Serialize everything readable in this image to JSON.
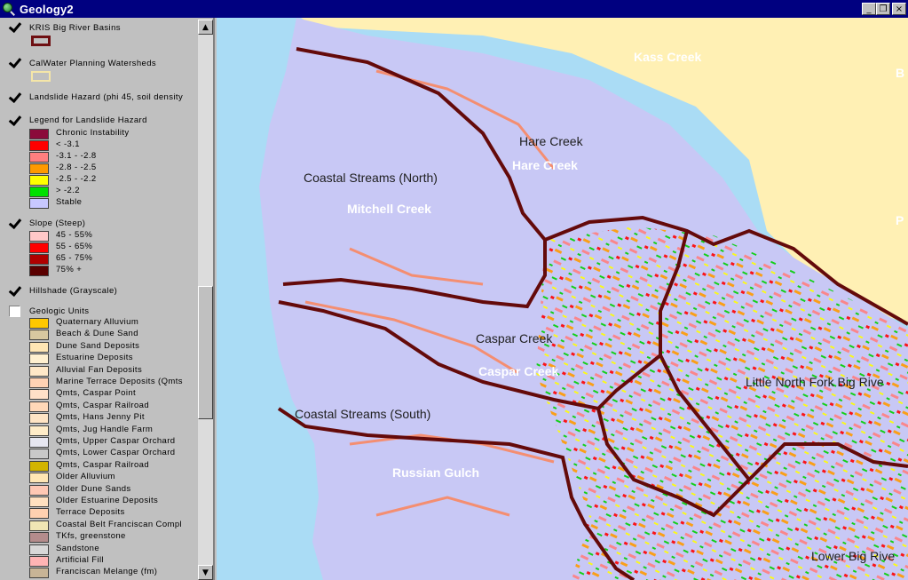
{
  "window": {
    "title": "Geology2",
    "buttons": {
      "minimize": "_",
      "restore": "❐",
      "close": "×"
    }
  },
  "legend": {
    "themes": [
      {
        "label": "KRIS Big River Basins",
        "checked": true,
        "symbol_color": "#6e0f12",
        "symbol_fill": "#c0c0c0"
      },
      {
        "label": "CalWater Planning Watersheds",
        "checked": true,
        "symbol_color": "#f5e6a8",
        "symbol_fill": "#c0c0c0"
      },
      {
        "label": "Landslide Hazard (phi 45, soil density",
        "checked": true
      },
      {
        "label": "Legend for Landslide Hazard",
        "checked": true,
        "classes": [
          {
            "label": "Chronic Instability",
            "color": "#8b0a3a"
          },
          {
            "label": "<  -3.1",
            "color": "#ff0000"
          },
          {
            "label": "-3.1 - -2.8",
            "color": "#ff7f7f"
          },
          {
            "label": "-2.8 - -2.5",
            "color": "#ff9a00"
          },
          {
            "label": "-2.5 - -2.2",
            "color": "#ffff00"
          },
          {
            "label": ">  -2.2",
            "color": "#00e000"
          },
          {
            "label": "Stable",
            "color": "#c8c8ff"
          }
        ]
      },
      {
        "label": "Slope (Steep)",
        "checked": true,
        "classes": [
          {
            "label": "45 - 55%",
            "color": "#ffc8c8"
          },
          {
            "label": "55 - 65%",
            "color": "#ff0000"
          },
          {
            "label": "65 - 75%",
            "color": "#b00000"
          },
          {
            "label": "75% +",
            "color": "#5a0000"
          }
        ]
      },
      {
        "label": "Hillshade (Grayscale)",
        "checked": true
      },
      {
        "label": "Geologic Units",
        "checked": false,
        "classes": [
          {
            "label": "Quaternary Alluvium",
            "color": "#ffc800"
          },
          {
            "label": "Beach & Dune Sand",
            "color": "#d8c8a0"
          },
          {
            "label": "Dune Sand Deposits",
            "color": "#ffe6b4"
          },
          {
            "label": "Estuarine Deposits",
            "color": "#fff0d0"
          },
          {
            "label": "Alluvial Fan Deposits",
            "color": "#ffe8c8"
          },
          {
            "label": "Marine Terrace Deposits (Qmts",
            "color": "#ffd2b4"
          },
          {
            "label": "Qmts, Caspar Point",
            "color": "#ffe0c8"
          },
          {
            "label": "Qmts, Caspar Railroad",
            "color": "#ffd8b8"
          },
          {
            "label": "Qmts, Hans Jenny Pit",
            "color": "#ffe4c4"
          },
          {
            "label": "Qmts, Jug Handle Farm",
            "color": "#ffecc8"
          },
          {
            "label": "Qmts, Upper Caspar Orchard",
            "color": "#e6e6f0"
          },
          {
            "label": "Qmts, Lower Caspar Orchard",
            "color": "#c8c8c8"
          },
          {
            "label": "Qmts, Caspar Railroad",
            "color": "#d2b400"
          },
          {
            "label": "Older Alluvium",
            "color": "#ffe6b4"
          },
          {
            "label": "Older Dune Sands",
            "color": "#ffc8b4"
          },
          {
            "label": "Older Estuarine Deposits",
            "color": "#ffe0c0"
          },
          {
            "label": "Terrace Deposits",
            "color": "#ffd0b0"
          },
          {
            "label": "Coastal Belt Franciscan Compl",
            "color": "#f0e6b4"
          },
          {
            "label": "TKfs, greenstone",
            "color": "#b48c8c"
          },
          {
            "label": "Sandstone",
            "color": "#d8d8d8"
          },
          {
            "label": "Artificial Fill",
            "color": "#ffb4b4"
          },
          {
            "label": "Franciscan Melange (fm)",
            "color": "#c8b496"
          }
        ]
      }
    ],
    "scroll": {
      "up": "▲",
      "down": "▼"
    }
  },
  "map": {
    "colors": {
      "ocean": "#aadcf5",
      "land": "#c8c8f5",
      "north_land": "#fff0b4",
      "basin": "#640a0a"
    },
    "labels": [
      {
        "text": "Kass Creek",
        "style": "white"
      },
      {
        "text": "Hare Creek",
        "style": "dark"
      },
      {
        "text": "Hare Creek",
        "style": "white"
      },
      {
        "text": "Coastal Streams (North)",
        "style": "dark"
      },
      {
        "text": "Mitchell Creek",
        "style": "white"
      },
      {
        "text": "Caspar Creek",
        "style": "dark"
      },
      {
        "text": "Caspar Creek",
        "style": "white"
      },
      {
        "text": "Little North Fork Big Rive",
        "style": "dark"
      },
      {
        "text": "Coastal Streams (South)",
        "style": "dark"
      },
      {
        "text": "Russian Gulch",
        "style": "white"
      },
      {
        "text": "Lower Big Rive",
        "style": "dark"
      },
      {
        "text": "B",
        "style": "white"
      },
      {
        "text": "P",
        "style": "white"
      }
    ]
  }
}
